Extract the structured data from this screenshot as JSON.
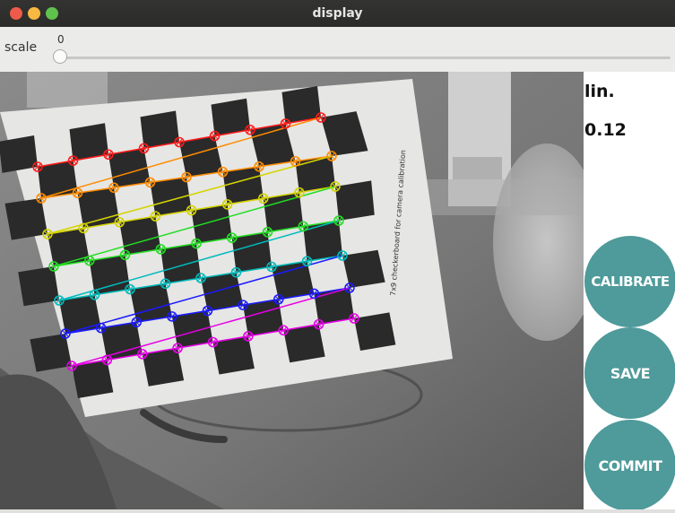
{
  "window": {
    "title": "display"
  },
  "toolbar": {
    "scale_label": "scale",
    "scale_value": "0",
    "slider_fraction": 0.0
  },
  "panel": {
    "mode_label": "lin.",
    "mode_value": "0.12",
    "calibrate_label": "CALIBRATE",
    "save_label": "SAVE",
    "commit_label": "COMMIT"
  },
  "board": {
    "caption": "7x9 checkerboard for camera calibration"
  },
  "colors": {
    "button": "#4f9a9a",
    "rows": [
      "#ff1a1a",
      "#ff8c00",
      "#d4d400",
      "#22dd22",
      "#00bbbb",
      "#1a1aff",
      "#e600e6"
    ]
  }
}
